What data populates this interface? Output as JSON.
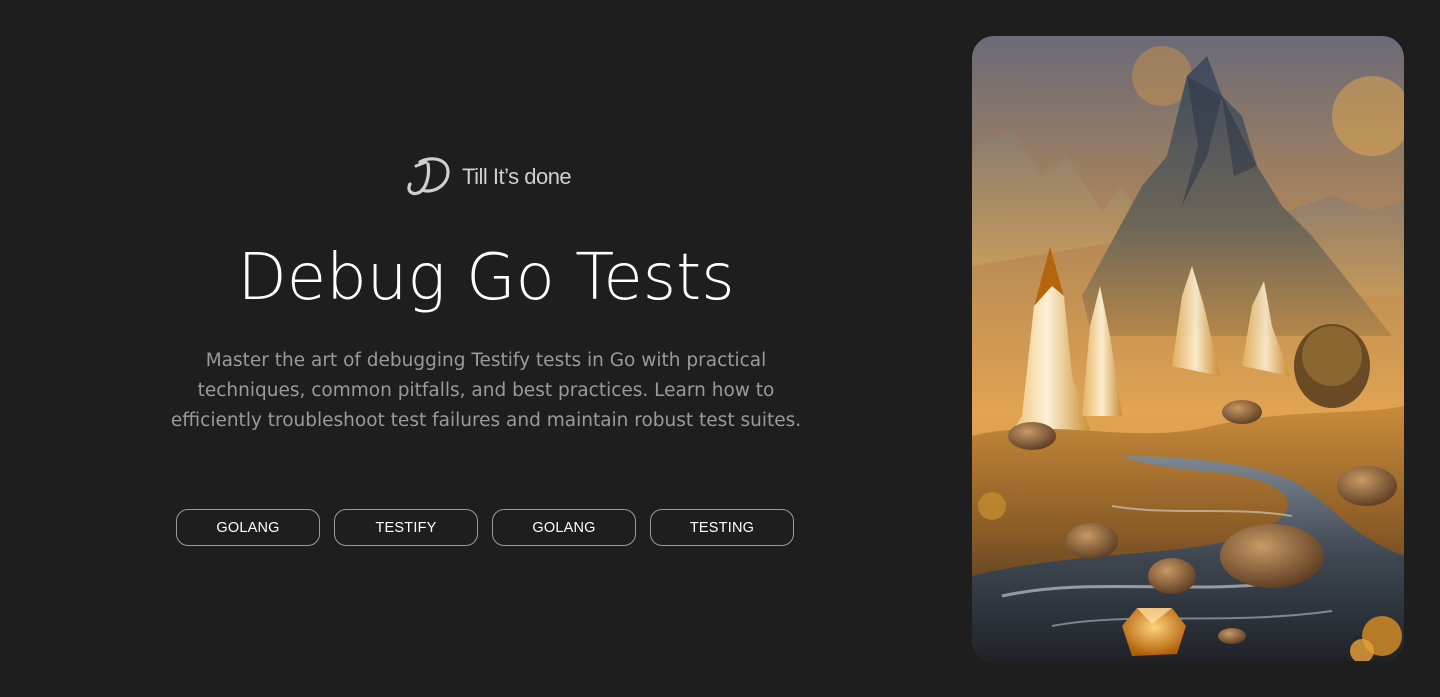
{
  "brand": {
    "name": "Till It’s done",
    "logo_icon": "signature-d-logo-icon"
  },
  "hero": {
    "title": "Debug Go Tests",
    "description": "Master the art of debugging Testify tests in Go with practical techniques, common pitfalls, and best practices. Learn how to efficiently troubleshoot test failures and maintain robust test suites."
  },
  "tags": [
    {
      "label": "GOLANG"
    },
    {
      "label": "TESTIFY"
    },
    {
      "label": "GOLANG"
    },
    {
      "label": "TESTING"
    }
  ],
  "cover_image": {
    "icon": "fantasy-landscape-image"
  },
  "colors": {
    "background": "#1e1e1e",
    "title": "#ffffff",
    "description": "#9a9a9a",
    "tag_border": "#9a9a9a",
    "accent_gold": "#e8a23a"
  }
}
